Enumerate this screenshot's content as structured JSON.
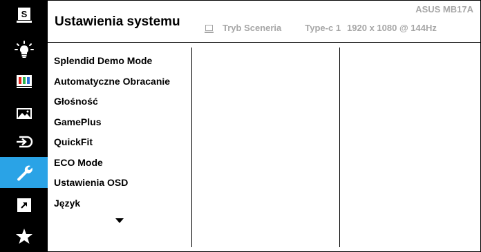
{
  "header": {
    "title": "Ustawienia systemu",
    "model": "ASUS MB17A",
    "mode_label": "Tryb Sceneria",
    "input_label": "Type-c 1",
    "resolution": "1920 x 1080 @ 144Hz"
  },
  "sidebar": {
    "items": [
      {
        "icon": "input-select-icon"
      },
      {
        "icon": "blue-light-filter-icon"
      },
      {
        "icon": "color-icon"
      },
      {
        "icon": "image-icon"
      },
      {
        "icon": "input-source-icon"
      },
      {
        "icon": "wrench-icon",
        "active": true
      },
      {
        "icon": "shortcut-icon"
      },
      {
        "icon": "star-favorite-icon"
      }
    ],
    "active_color": "#2aa3e6"
  },
  "menu": {
    "items": [
      "Splendid Demo Mode",
      "Automatyczne Obracanie",
      "Głośność",
      "GamePlus",
      "QuickFit",
      "ECO Mode",
      "Ustawienia OSD",
      "Język"
    ],
    "more_icon": "triangle-down-icon"
  }
}
